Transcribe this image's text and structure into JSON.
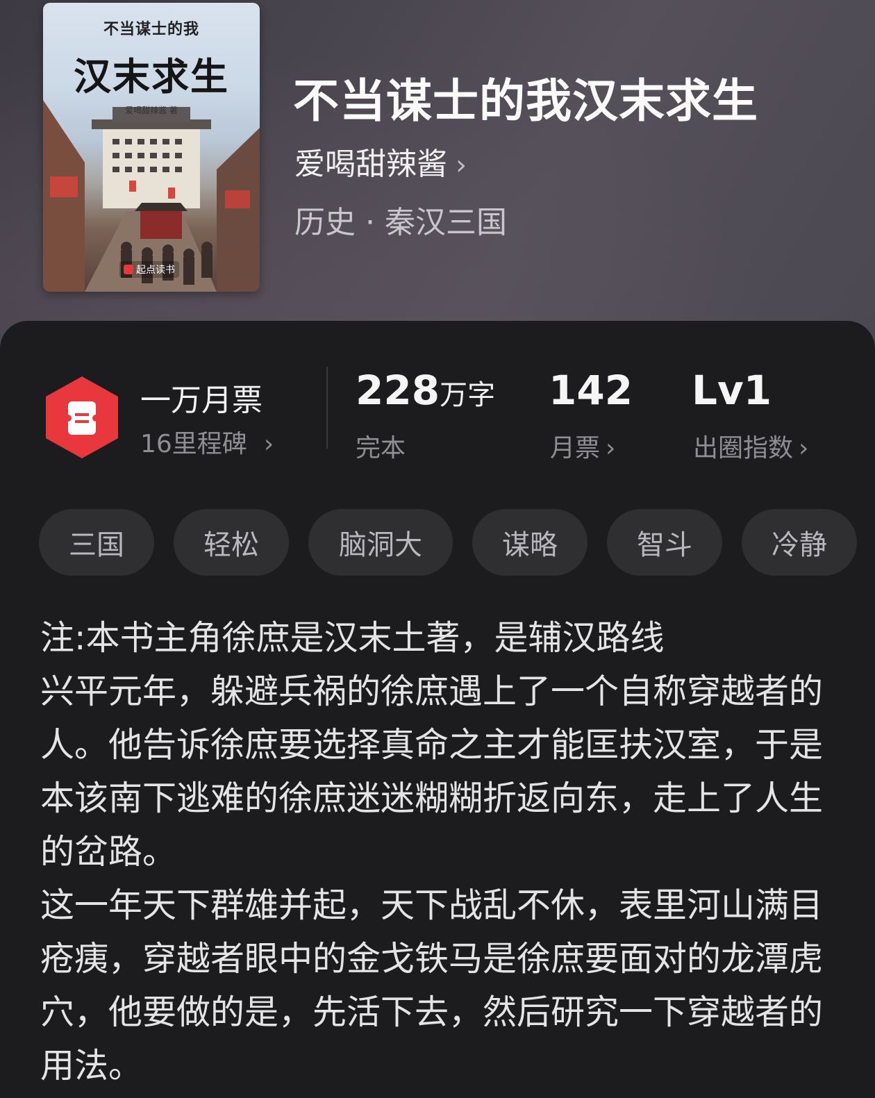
{
  "book": {
    "title": "不当谋士的我汉末求生",
    "author": "爱喝甜辣酱",
    "author_chevron": "›",
    "category": "历史 · 秦汉三国"
  },
  "cover": {
    "small_title": "不当谋士的我",
    "big_title": "汉末求生",
    "author_line": "爱喝甜辣酱 著",
    "publisher": "起点读书"
  },
  "stats": {
    "milestone": {
      "title": "一万月票",
      "subtitle": "16里程碑",
      "chevron": "›"
    },
    "words": {
      "number": "228",
      "unit": "万字",
      "label": "完本"
    },
    "monthly_tickets": {
      "number": "142",
      "label": "月票",
      "chevron": "›"
    },
    "circle_index": {
      "number": "Lv1",
      "label": "出圈指数",
      "chevron": "›"
    }
  },
  "tags": [
    "三国",
    "轻松",
    "脑洞大",
    "谋略",
    "智斗",
    "冷静"
  ],
  "description": {
    "note": "注:本书主角徐庶是汉末土著，是辅汉路线",
    "para1": "兴平元年，躲避兵祸的徐庶遇上了一个自称穿越者的人。他告诉徐庶要选择真命之主才能匡扶汉室，于是本该南下逃难的徐庶迷迷糊糊折返向东，走上了人生的岔路。",
    "para2": "这一年天下群雄并起，天下战乱不休，表里河山满目疮痍，穿越者眼中的金戈铁马是徐庶要面对的龙潭虎穴，他要做的是，先活下去，然后研究一下穿越者的用法。"
  },
  "colors": {
    "card_bg": "#1c1c1e",
    "tag_bg": "#2f2f32",
    "milestone_icon": "#e8383d"
  },
  "icons": {
    "milestone": "ticket-hexagon-icon"
  }
}
